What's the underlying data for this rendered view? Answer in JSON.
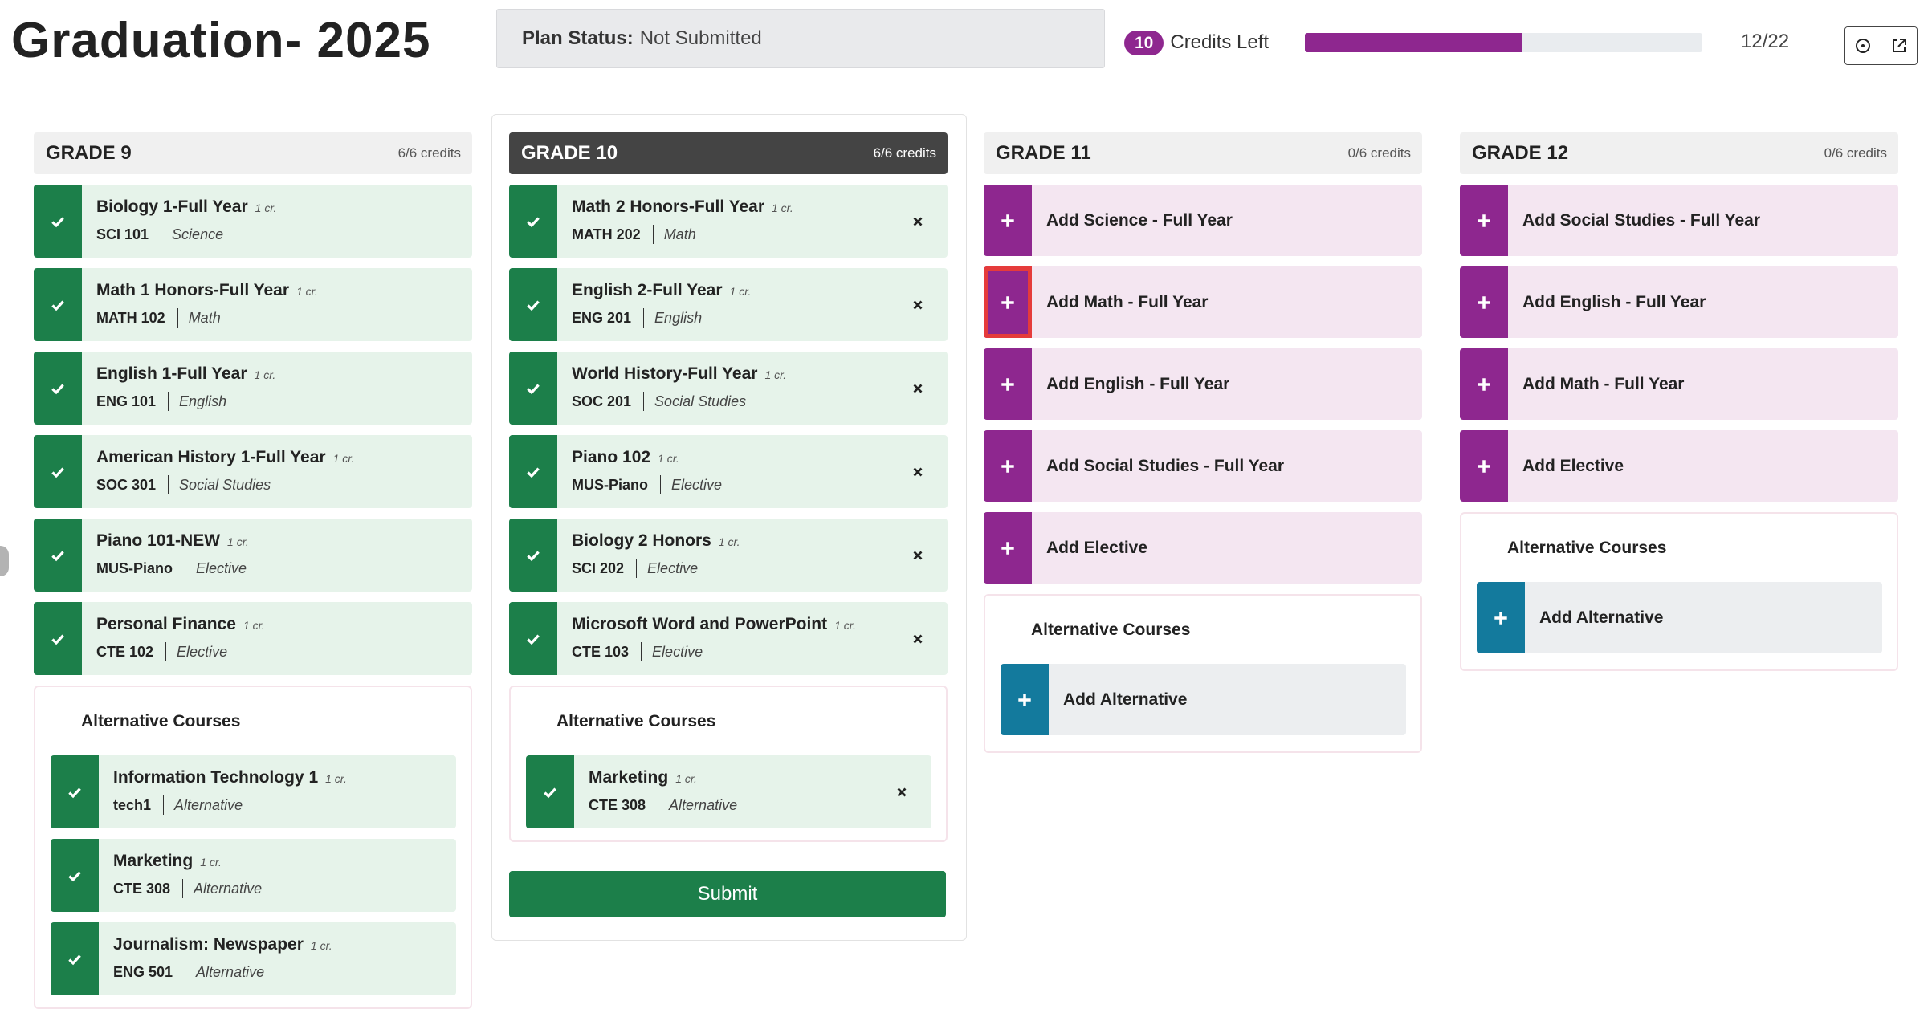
{
  "header": {
    "title": "Graduation- 2025",
    "plan_status_label": "Plan Status:",
    "plan_status_value": "Not Submitted",
    "credits_left_count": "10",
    "credits_left_label": "Credits Left",
    "progress_text": "12/22",
    "progress_fraction": 0.545,
    "actions": [
      {
        "icon": "clock-icon"
      },
      {
        "icon": "external-link-icon"
      }
    ]
  },
  "grades": [
    {
      "title": "GRADE 9",
      "credits": "6/6 credits",
      "active": false,
      "courses": [
        {
          "name": "Biology 1-Full Year",
          "credit": "1 cr.",
          "code": "SCI 101",
          "category": "Science",
          "removable": false
        },
        {
          "name": "Math 1 Honors-Full Year",
          "credit": "1 cr.",
          "code": "MATH 102",
          "category": "Math",
          "removable": false
        },
        {
          "name": "English 1-Full Year",
          "credit": "1 cr.",
          "code": "ENG 101",
          "category": "English",
          "removable": false
        },
        {
          "name": "American History 1-Full Year",
          "credit": "1 cr.",
          "code": "SOC 301",
          "category": "Social Studies",
          "removable": false
        },
        {
          "name": "Piano 101-NEW",
          "credit": "1 cr.",
          "code": "MUS-Piano",
          "category": "Elective",
          "removable": false
        },
        {
          "name": "Personal Finance",
          "credit": "1 cr.",
          "code": "CTE 102",
          "category": "Elective",
          "removable": false
        }
      ],
      "add_slots": [],
      "alternatives_title": "Alternative Courses",
      "alternatives": [
        {
          "name": "Information Technology 1",
          "credit": "1 cr.",
          "code": "tech1",
          "category": "Alternative",
          "removable": false
        },
        {
          "name": "Marketing",
          "credit": "1 cr.",
          "code": "CTE 308",
          "category": "Alternative",
          "removable": false
        },
        {
          "name": "Journalism: Newspaper",
          "credit": "1 cr.",
          "code": "ENG 501",
          "category": "Alternative",
          "removable": false
        }
      ],
      "add_alternative": null
    },
    {
      "title": "GRADE 10",
      "credits": "6/6 credits",
      "active": true,
      "courses": [
        {
          "name": "Math 2 Honors-Full Year",
          "credit": "1 cr.",
          "code": "MATH 202",
          "category": "Math",
          "removable": true
        },
        {
          "name": "English 2-Full Year",
          "credit": "1 cr.",
          "code": "ENG 201",
          "category": "English",
          "removable": true
        },
        {
          "name": "World History-Full Year",
          "credit": "1 cr.",
          "code": "SOC 201",
          "category": "Social Studies",
          "removable": true
        },
        {
          "name": "Piano 102",
          "credit": "1 cr.",
          "code": "MUS-Piano",
          "category": "Elective",
          "removable": true
        },
        {
          "name": "Biology 2 Honors",
          "credit": "1 cr.",
          "code": "SCI 202",
          "category": "Elective",
          "removable": true
        },
        {
          "name": "Microsoft Word and PowerPoint",
          "credit": "1 cr.",
          "code": "CTE 103",
          "category": "Elective",
          "removable": true
        }
      ],
      "add_slots": [],
      "alternatives_title": "Alternative Courses",
      "alternatives": [
        {
          "name": "Marketing",
          "credit": "1 cr.",
          "code": "CTE 308",
          "category": "Alternative",
          "removable": true
        }
      ],
      "add_alternative": null,
      "submit_label": "Submit"
    },
    {
      "title": "GRADE 11",
      "credits": "0/6 credits",
      "active": false,
      "courses": [],
      "add_slots": [
        {
          "label": "Add Science - Full Year",
          "highlighted": false
        },
        {
          "label": "Add Math - Full Year",
          "highlighted": true
        },
        {
          "label": "Add English - Full Year",
          "highlighted": false
        },
        {
          "label": "Add Social Studies - Full Year",
          "highlighted": false
        },
        {
          "label": "Add Elective",
          "highlighted": false
        }
      ],
      "alternatives_title": "Alternative Courses",
      "alternatives": [],
      "add_alternative": "Add Alternative"
    },
    {
      "title": "GRADE 12",
      "credits": "0/6 credits",
      "active": false,
      "courses": [],
      "add_slots": [
        {
          "label": "Add Social Studies - Full Year",
          "highlighted": false
        },
        {
          "label": "Add English - Full Year",
          "highlighted": false
        },
        {
          "label": "Add Math - Full Year",
          "highlighted": false
        },
        {
          "label": "Add Elective",
          "highlighted": false
        }
      ],
      "alternatives_title": "Alternative Courses",
      "alternatives": [],
      "add_alternative": "Add Alternative"
    }
  ]
}
